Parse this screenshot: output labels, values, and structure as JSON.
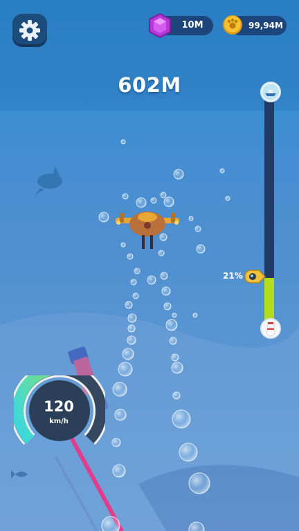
{
  "hud": {
    "gems": {
      "value": "10M",
      "icon": "gem-icon",
      "color": "#b538d8"
    },
    "coins": {
      "value": "99,94M",
      "icon": "coin-icon",
      "color": "#f2b625"
    },
    "settings_icon": "gear-icon"
  },
  "depth": {
    "value": "602M"
  },
  "progress": {
    "label": "21%",
    "fraction": 0.21,
    "top_icon": "surface-boat-icon",
    "bottom_icon": "snowman-icon",
    "marker_icon": "submarine-marker-icon",
    "fill_color": "#b5dc1a"
  },
  "speedometer": {
    "value": "120",
    "unit": "km/h",
    "fraction": 0.5
  }
}
